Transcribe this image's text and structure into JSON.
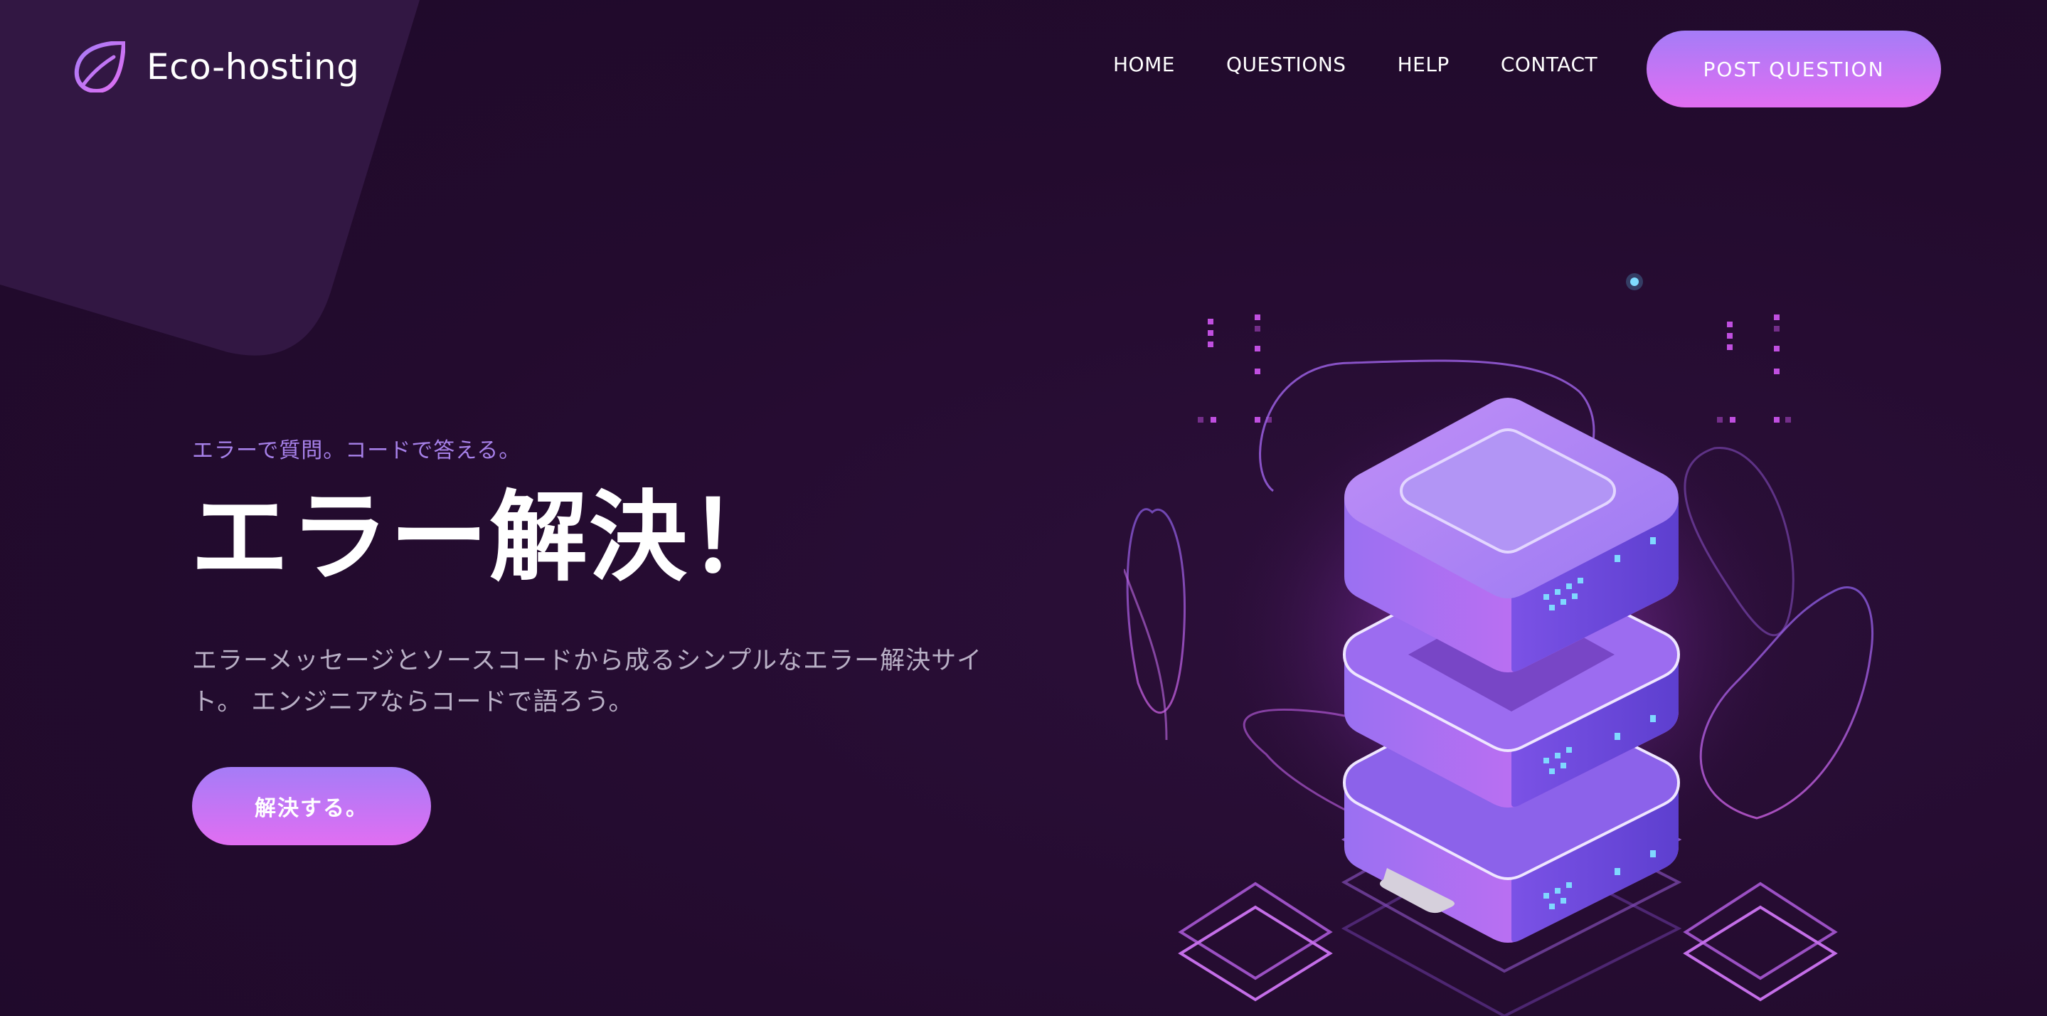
{
  "brand": {
    "name": "Eco-hosting",
    "icon": "leaf-icon"
  },
  "nav": {
    "items": [
      "HOME",
      "QUESTIONS",
      "HELP",
      "CONTACT"
    ],
    "post_button": "POST QUESTION"
  },
  "hero": {
    "eyebrow": "エラーで質問。コードで答える。",
    "title": "エラー解決！",
    "description": "エラーメッセージとソースコードから成るシンプルなエラー解決サイト。 エンジニアならコードで語ろう。",
    "cta": "解決する。",
    "illustration": "server-stack-illustration"
  },
  "colors": {
    "background": "#230b2e",
    "accent_start": "#a57cf7",
    "accent_end": "#e16ef2",
    "eyebrow": "#a781ea"
  }
}
